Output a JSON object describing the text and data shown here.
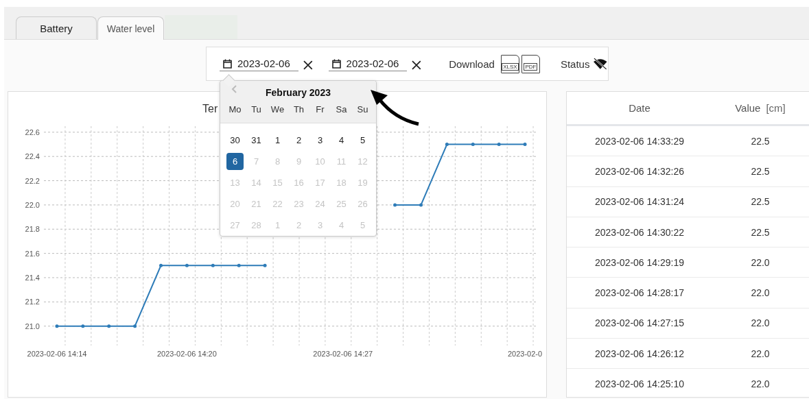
{
  "tabs": [
    {
      "label": "Battery",
      "selected": false
    },
    {
      "label": "Water level",
      "selected": true
    }
  ],
  "toolbar": {
    "date_from": {
      "value": "2023-02-06"
    },
    "date_to": {
      "value": "2023-02-06"
    },
    "download": {
      "label": "Download",
      "files": [
        "XLSX",
        "PDF"
      ]
    },
    "status": {
      "label": "Status"
    }
  },
  "date_picker": {
    "title": "February 2023",
    "weekdays": [
      "Mo",
      "Tu",
      "We",
      "Th",
      "Fr",
      "Sa",
      "Su"
    ],
    "weeks": [
      [
        {
          "label": "30",
          "selected": false,
          "disabled": false
        },
        {
          "label": "31",
          "selected": false,
          "disabled": false
        },
        {
          "label": "1",
          "selected": false,
          "disabled": false
        },
        {
          "label": "2",
          "selected": false,
          "disabled": false
        },
        {
          "label": "3",
          "selected": false,
          "disabled": false
        },
        {
          "label": "4",
          "selected": false,
          "disabled": false
        },
        {
          "label": "5",
          "selected": false,
          "disabled": false
        }
      ],
      [
        {
          "label": "6",
          "selected": true,
          "disabled": false
        },
        {
          "label": "7",
          "selected": false,
          "disabled": true
        },
        {
          "label": "8",
          "selected": false,
          "disabled": true
        },
        {
          "label": "9",
          "selected": false,
          "disabled": true
        },
        {
          "label": "10",
          "selected": false,
          "disabled": true
        },
        {
          "label": "11",
          "selected": false,
          "disabled": true
        },
        {
          "label": "12",
          "selected": false,
          "disabled": true
        }
      ],
      [
        {
          "label": "13",
          "selected": false,
          "disabled": true
        },
        {
          "label": "14",
          "selected": false,
          "disabled": true
        },
        {
          "label": "15",
          "selected": false,
          "disabled": true
        },
        {
          "label": "16",
          "selected": false,
          "disabled": true
        },
        {
          "label": "17",
          "selected": false,
          "disabled": true
        },
        {
          "label": "18",
          "selected": false,
          "disabled": true
        },
        {
          "label": "19",
          "selected": false,
          "disabled": true
        }
      ],
      [
        {
          "label": "20",
          "selected": false,
          "disabled": true
        },
        {
          "label": "21",
          "selected": false,
          "disabled": true
        },
        {
          "label": "22",
          "selected": false,
          "disabled": true
        },
        {
          "label": "23",
          "selected": false,
          "disabled": true
        },
        {
          "label": "24",
          "selected": false,
          "disabled": true
        },
        {
          "label": "25",
          "selected": false,
          "disabled": true
        },
        {
          "label": "26",
          "selected": false,
          "disabled": true
        }
      ],
      [
        {
          "label": "27",
          "selected": false,
          "disabled": true
        },
        {
          "label": "28",
          "selected": false,
          "disabled": true
        },
        {
          "label": "1",
          "selected": false,
          "disabled": true
        },
        {
          "label": "2",
          "selected": false,
          "disabled": true
        },
        {
          "label": "3",
          "selected": false,
          "disabled": true
        },
        {
          "label": "4",
          "selected": false,
          "disabled": true
        },
        {
          "label": "5",
          "selected": false,
          "disabled": true
        }
      ]
    ]
  },
  "chart": {
    "chart_data": {
      "type": "line",
      "title": "Ter",
      "categories": [
        "2023-02-06 14:14",
        null,
        null,
        null,
        null,
        "2023-02-06 14:20",
        null,
        null,
        null,
        null,
        null,
        "2023-02-06 14:27",
        null,
        null,
        null,
        null,
        null,
        null,
        "2023-02-0"
      ],
      "series": [
        {
          "color": "#2e7cb8",
          "values": [
            21.0,
            21.0,
            21.0,
            21.0,
            21.5,
            21.5,
            21.5,
            21.5,
            21.5,
            null,
            null,
            null,
            null,
            22.0,
            22.0,
            22.5,
            22.5,
            22.5,
            22.5
          ]
        }
      ],
      "ylim": [
        20.84,
        22.65
      ],
      "grid": true,
      "yticks": [
        {
          "value": 21.0,
          "label": "21.0"
        },
        {
          "value": 21.2,
          "label": "21.2"
        },
        {
          "value": 21.4,
          "label": "21.4"
        },
        {
          "value": 21.6,
          "label": "21.6"
        },
        {
          "value": 21.8,
          "label": "21.8"
        },
        {
          "value": 22.0,
          "label": "22.0"
        },
        {
          "value": 22.2,
          "label": "22.2"
        },
        {
          "value": 22.4,
          "label": "22.4"
        },
        {
          "value": 22.6,
          "label": "22.6"
        }
      ]
    }
  },
  "table": {
    "columns": [
      {
        "label": "Date"
      },
      {
        "label": "Value",
        "unit": "[cm]"
      }
    ],
    "rows": [
      [
        "2023-02-06 14:33:29",
        "22.5"
      ],
      [
        "2023-02-06 14:32:26",
        "22.5"
      ],
      [
        "2023-02-06 14:31:24",
        "22.5"
      ],
      [
        "2023-02-06 14:30:22",
        "22.5"
      ],
      [
        "2023-02-06 14:29:19",
        "22.0"
      ],
      [
        "2023-02-06 14:28:17",
        "22.0"
      ],
      [
        "2023-02-06 14:27:15",
        "22.0"
      ],
      [
        "2023-02-06 14:26:12",
        "22.0"
      ],
      [
        "2023-02-06 14:25:10",
        "22.0"
      ]
    ]
  }
}
